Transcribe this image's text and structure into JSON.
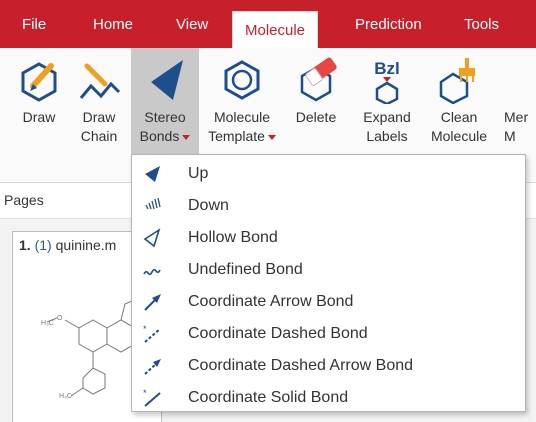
{
  "menu": {
    "file": "File",
    "home": "Home",
    "view": "View",
    "molecule": "Molecule",
    "prediction": "Prediction",
    "tools": "Tools"
  },
  "ribbon": {
    "draw": "Draw",
    "draw_chain": "Draw\nChain",
    "stereo_bonds": "Stereo\nBonds",
    "molecule_template": "Molecule\nTemplate",
    "delete": "Delete",
    "expand_labels": "Expand\nLabels",
    "expand_icon_text": "Bzl",
    "clean_molecule": "Clean\nMolecule",
    "merge_partial": "Mer\nM"
  },
  "pages": {
    "title": "Pages",
    "card_number": "1.",
    "card_index": "(1)",
    "card_name": "quinine.m"
  },
  "dropdown": {
    "items": [
      {
        "label": "Up",
        "icon": "wedge-up-icon"
      },
      {
        "label": "Down",
        "icon": "hashed-wedge-icon"
      },
      {
        "label": "Hollow Bond",
        "icon": "hollow-wedge-icon"
      },
      {
        "label": "Undefined Bond",
        "icon": "wavy-bond-icon"
      },
      {
        "label": "Coordinate Arrow Bond",
        "icon": "arrow-bond-icon"
      },
      {
        "label": "Coordinate Dashed Bond",
        "icon": "dashed-bond-icon"
      },
      {
        "label": "Coordinate Dashed Arrow Bond",
        "icon": "dashed-arrow-bond-icon"
      },
      {
        "label": "Coordinate Solid Bond",
        "icon": "solid-bond-icon"
      }
    ]
  },
  "colors": {
    "accent": "#c8202a",
    "icon_blue": "#1f4e8c",
    "icon_orange": "#f0a020"
  }
}
